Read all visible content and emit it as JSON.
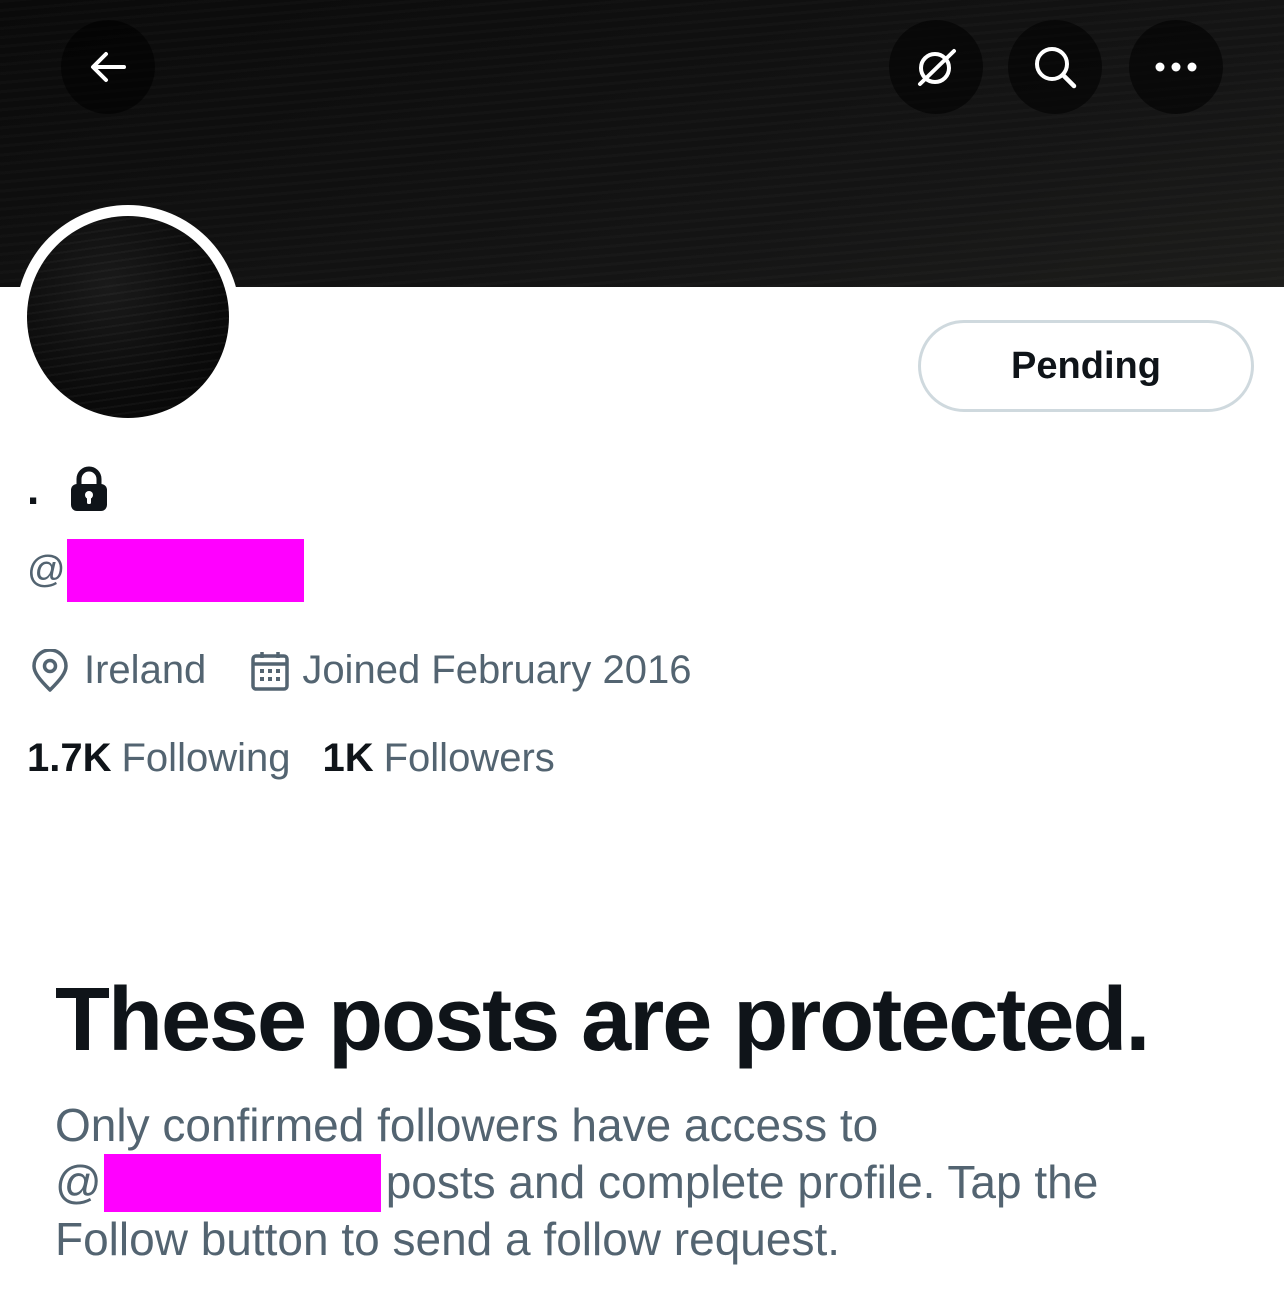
{
  "header": {
    "back_icon": "arrow-left-icon",
    "grok_icon": "grok-icon",
    "search_icon": "search-icon",
    "more_icon": "more-horizontal-icon"
  },
  "profile": {
    "display_name": ".",
    "protected_icon": "lock-icon",
    "handle_prefix": "@",
    "redaction_color": "#ff00ff",
    "follow_button_label": "Pending",
    "location_icon": "location-pin-icon",
    "location": "Ireland",
    "joined_icon": "calendar-icon",
    "joined": "Joined February 2016",
    "following_count": "1.7K",
    "following_label": "Following",
    "followers_count": "1K",
    "followers_label": "Followers"
  },
  "protected_notice": {
    "title": "These posts are protected.",
    "line1": "Only confirmed followers have access to",
    "handle_prefix": "@",
    "line2_rest": "posts and complete profile. Tap the",
    "line3": "Follow button to send a follow request."
  },
  "colors": {
    "text_primary": "#0f1419",
    "text_secondary": "#536471",
    "button_border": "#cfd9de",
    "banner": "#0a0a0a"
  }
}
